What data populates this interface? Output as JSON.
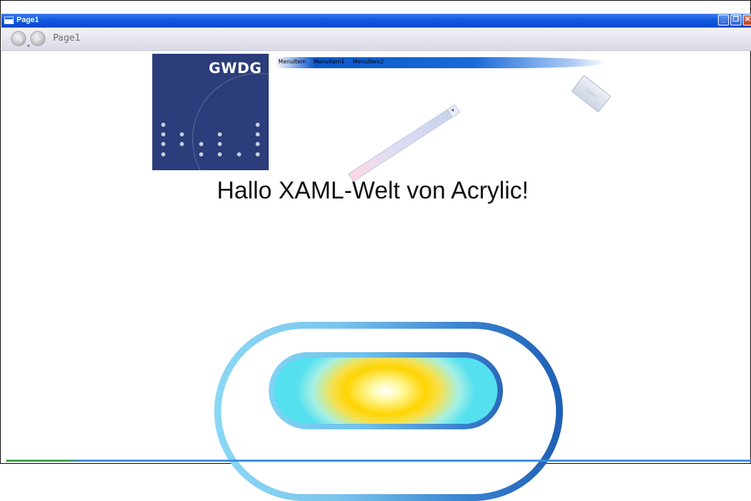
{
  "window": {
    "title": "Page1"
  },
  "nav": {
    "title": "Page1"
  },
  "logo": {
    "text": "GWDG"
  },
  "menu": {
    "items": [
      "MenuItem",
      "MenuItem1",
      "MenuItem2"
    ]
  },
  "rotated_button": {
    "label": "Button"
  },
  "heading": {
    "text": "Hallo XAML-Welt von Acrylic!"
  },
  "colors": {
    "titlebar": "#0f5ae0",
    "logo_bg": "#2b3d7a",
    "menubar": "#0d58c8",
    "pill_outer": "#7bc6ee",
    "pill_fill_center": "#ffd400"
  }
}
